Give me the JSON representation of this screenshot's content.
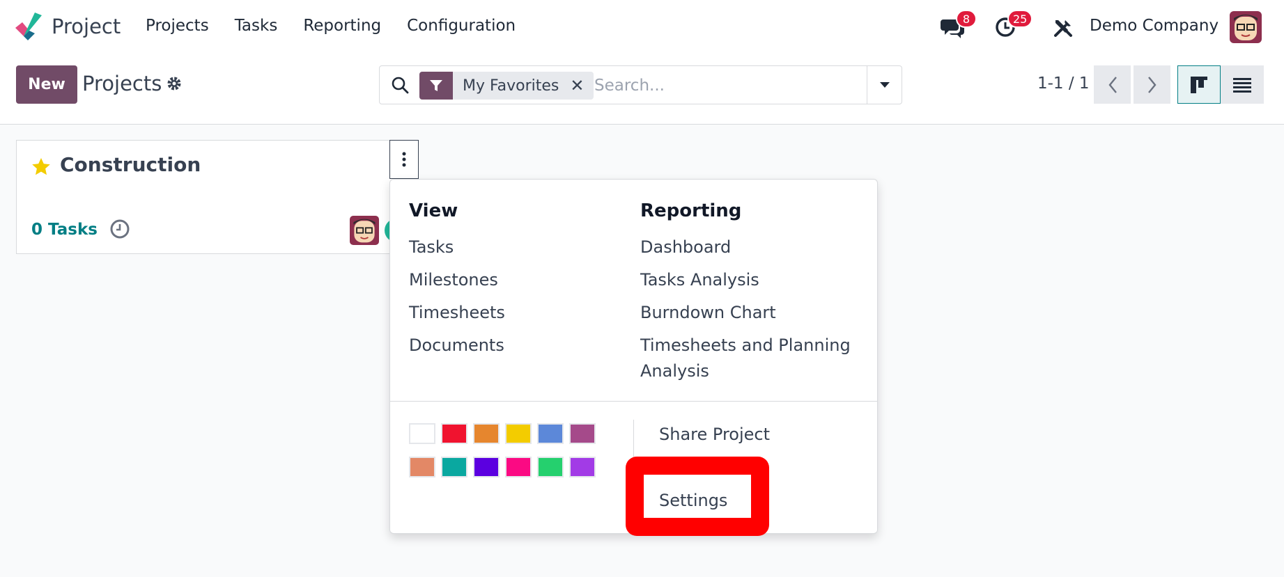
{
  "navbar": {
    "app_title": "Project",
    "menu": [
      "Projects",
      "Tasks",
      "Reporting",
      "Configuration"
    ],
    "messages_badge": "8",
    "activities_badge": "25",
    "company": "Demo Company",
    "icons": [
      "chat-icon",
      "clock-icon",
      "tools-icon"
    ]
  },
  "control": {
    "new_label": "New",
    "breadcrumb": "Projects",
    "search": {
      "facet_label": "My Favorites",
      "placeholder": "Search..."
    },
    "pager": "1-1 / 1"
  },
  "card": {
    "title": "Construction",
    "tasks_label": "0 Tasks"
  },
  "dropdown": {
    "view_heading": "View",
    "view_items": [
      "Tasks",
      "Milestones",
      "Timesheets",
      "Documents"
    ],
    "reporting_heading": "Reporting",
    "reporting_items": [
      "Dashboard",
      "Tasks Analysis",
      "Burndown Chart",
      "Timesheets and Planning",
      "Analysis"
    ],
    "actions": [
      "Share Project",
      "Settings"
    ],
    "colors": [
      "#ffffff",
      "#f0132f",
      "#e6862e",
      "#f3cc00",
      "#5c88d9",
      "#a54a8a",
      "#e38866",
      "#0aa8a0",
      "#5b00e0",
      "#fb0a83",
      "#25d06e",
      "#a23be6"
    ]
  },
  "colors": {
    "brand": "#714b67",
    "accent_teal": "#017e84",
    "highlight": "#ff0000"
  }
}
